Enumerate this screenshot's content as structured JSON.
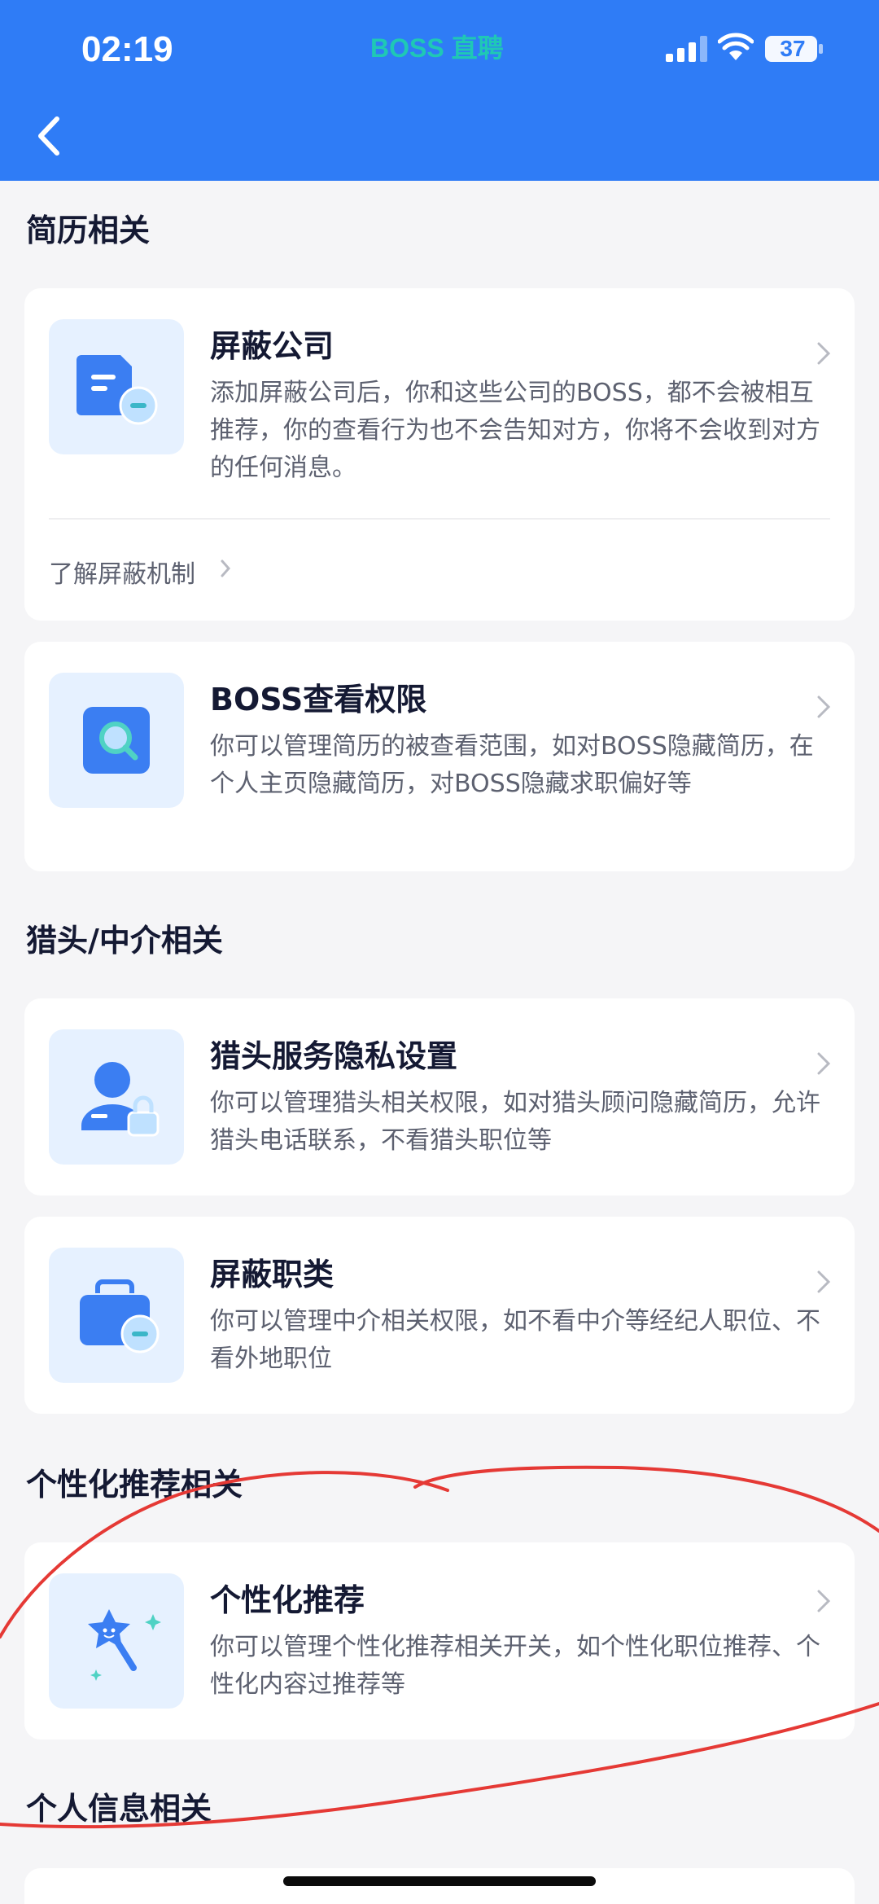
{
  "status_bar": {
    "time": "02:19",
    "app_label": "BOSS 直聘",
    "battery": "37"
  },
  "header": {
    "back_icon": "chevron-left-icon"
  },
  "sections": [
    {
      "title": "简历相关",
      "items": [
        {
          "title": "屏蔽公司",
          "desc": "添加屏蔽公司后，你和这些公司的BOSS，都不会被相互推荐，你的查看行为也不会告知对方，你将不会收到对方的任何消息。",
          "icon": "document-minus-icon",
          "link": "了解屏蔽机制"
        },
        {
          "title": "BOSS查看权限",
          "desc": "你可以管理简历的被查看范围，如对BOSS隐藏简历，在个人主页隐藏简历，对BOSS隐藏求职偏好等",
          "icon": "magnifier-icon"
        }
      ]
    },
    {
      "title": "猎头/中介相关",
      "items": [
        {
          "title": "猎头服务隐私设置",
          "desc": "你可以管理猎头相关权限，如对猎头顾问隐藏简历，允许猎头电话联系，不看猎头职位等",
          "icon": "user-lock-icon"
        },
        {
          "title": "屏蔽职类",
          "desc": "你可以管理中介相关权限，如不看中介等经纪人职位、不看外地职位",
          "icon": "briefcase-minus-icon"
        }
      ]
    },
    {
      "title": "个性化推荐相关",
      "items": [
        {
          "title": "个性化推荐",
          "desc": "你可以管理个性化推荐相关开关，如个性化职位推荐、个性化内容过推荐等",
          "icon": "magic-star-icon"
        }
      ]
    },
    {
      "title": "个人信息相关"
    }
  ],
  "colors": {
    "header_bg": "#2f7cf6",
    "icon_bg": "#e6f1ff",
    "icon_primary": "#3b7ef2",
    "annotation": "#e53935"
  }
}
